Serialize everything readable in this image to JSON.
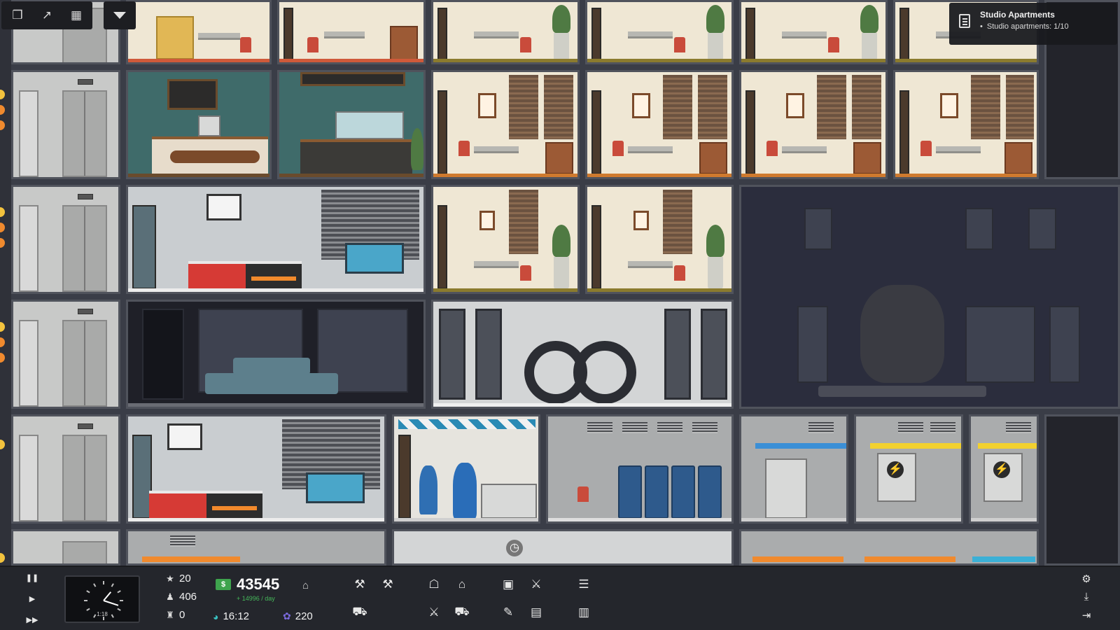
{
  "notification": {
    "title": "Studio Apartments",
    "line": "Studio apartments: 1/10"
  },
  "top_toolbar": {
    "buttons": [
      {
        "name": "windows-icon",
        "glyph": "❒"
      },
      {
        "name": "stairs-icon",
        "glyph": "↗"
      },
      {
        "name": "building-icon",
        "glyph": "▦"
      }
    ],
    "dropdown_icon": "chevron-down-icon"
  },
  "hud": {
    "speed": {
      "pause": "❚❚",
      "play": "▶",
      "fast": "▶▶"
    },
    "clock_time": "1:18",
    "stars": "20",
    "population": "406",
    "unemployed": "0",
    "money": "43545",
    "money_rate": "+ 14996 / day",
    "time": "16:12",
    "karma": "220",
    "money_icon_label": "$"
  },
  "tools": [
    {
      "name": "construction-icon",
      "glyph": "⚒"
    },
    {
      "name": "hammer-icon",
      "glyph": "⚒"
    },
    {
      "name": "office-icon",
      "glyph": "☖"
    },
    {
      "name": "home-icon",
      "glyph": "⌂"
    },
    {
      "name": "box-icon",
      "glyph": "▣"
    },
    {
      "name": "handshake-icon",
      "glyph": "⚔"
    },
    {
      "name": "document-icon",
      "glyph": "☰"
    },
    {
      "name": "bulldozer-icon",
      "glyph": "⛟"
    },
    {
      "name": "restaurant-icon",
      "glyph": "⚔"
    },
    {
      "name": "shopping-cart-icon",
      "glyph": "⛟"
    },
    {
      "name": "brush-icon",
      "glyph": "✎"
    },
    {
      "name": "gallery-icon",
      "glyph": "▤"
    },
    {
      "name": "stats-icon",
      "glyph": "▥"
    }
  ],
  "system": [
    {
      "name": "settings-icon",
      "glyph": "⚙"
    },
    {
      "name": "download-icon",
      "glyph": "⤓"
    },
    {
      "name": "exit-icon",
      "glyph": "⇥"
    }
  ],
  "colors": {
    "money_green": "#3ea44d",
    "star_yellow": "#f4d24a",
    "karma_purple": "#7c6be0"
  }
}
